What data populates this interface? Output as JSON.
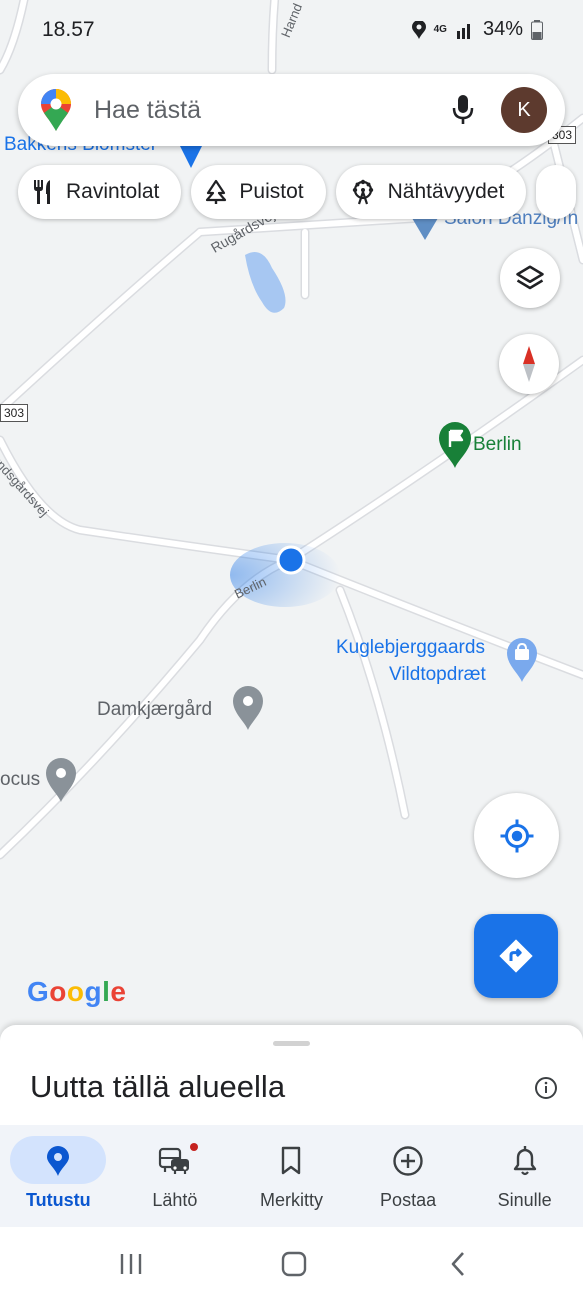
{
  "status_bar": {
    "time": "18.57",
    "network": "4G",
    "battery": "34%"
  },
  "search": {
    "placeholder": "Hae tästä",
    "avatar_letter": "K"
  },
  "chips": [
    {
      "label": "Ravintolat",
      "icon": "restaurant-icon"
    },
    {
      "label": "Puistot",
      "icon": "tree-icon"
    },
    {
      "label": "Nähtävyydet",
      "icon": "ferris-wheel-icon"
    }
  ],
  "map": {
    "places": [
      {
        "name": "Berlin",
        "color": "#188038"
      },
      {
        "name": "Kuglebjerggaards",
        "color": "#1a73e8"
      },
      {
        "name": "Vildtopdræt",
        "color": "#1a73e8"
      },
      {
        "name": "Damkjærgård",
        "color": "#5f6368"
      },
      {
        "name": "ocus",
        "color": "#5f6368"
      },
      {
        "name": "Bakkens Blomster",
        "color": "#1a73e8"
      },
      {
        "name": "Salon Danzig/In",
        "color": "#1a73e8"
      }
    ],
    "roads": [
      "Rugårdsvej",
      "Berlin",
      "undsgårdsvej",
      "Harnd"
    ],
    "route_shields": [
      "303",
      "303"
    ],
    "google_logo": "Google"
  },
  "bottom_sheet": {
    "title": "Uutta tällä alueella"
  },
  "bottom_nav": [
    {
      "label": "Tutustu",
      "icon": "explore-pin-icon",
      "active": true
    },
    {
      "label": "Lähtö",
      "icon": "commute-icon",
      "active": false,
      "badge": true
    },
    {
      "label": "Merkitty",
      "icon": "bookmark-icon",
      "active": false
    },
    {
      "label": "Postaa",
      "icon": "add-circle-icon",
      "active": false
    },
    {
      "label": "Sinulle",
      "icon": "bell-icon",
      "active": false
    }
  ],
  "colors": {
    "accent": "#1a73e8",
    "map_bg": "#f1f3f4",
    "water": "#a7c7f2",
    "place_green": "#188038"
  }
}
